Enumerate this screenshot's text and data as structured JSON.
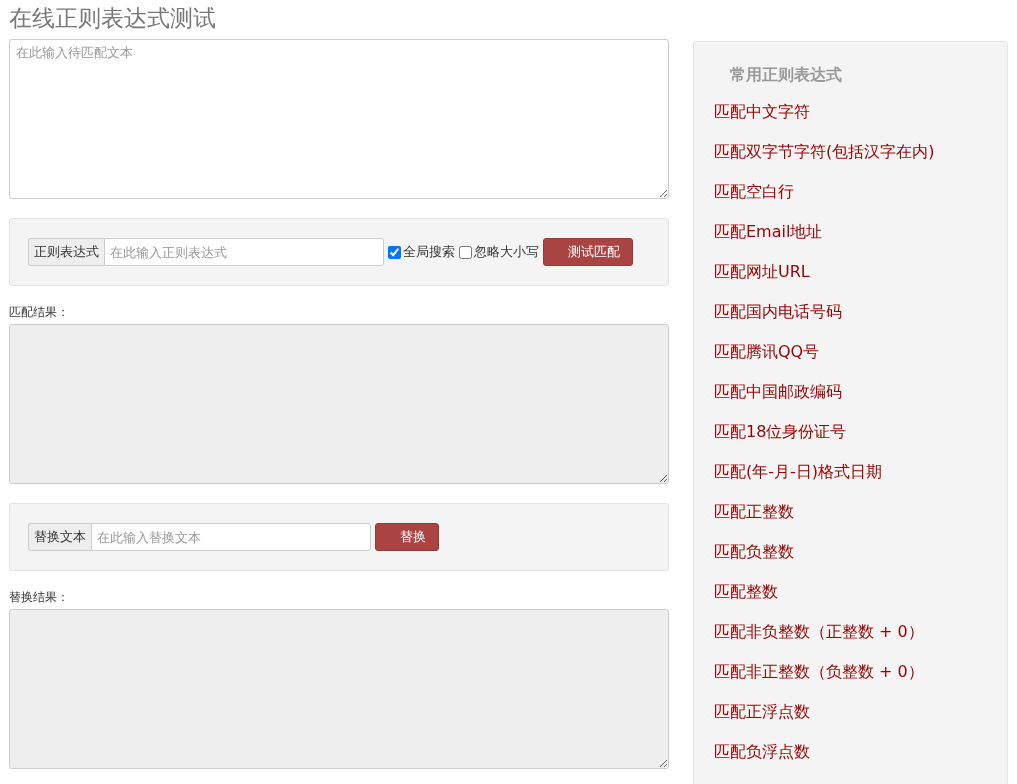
{
  "title": "在线正则表达式测试",
  "source_text": {
    "placeholder": "在此输入待匹配文本"
  },
  "regex_bar": {
    "addon": "正则表达式",
    "placeholder": "在此输入正则表达式",
    "options": [
      {
        "label": "全局搜索",
        "checked": true
      },
      {
        "label": "忽略大小写",
        "checked": false
      }
    ],
    "button": "测试匹配"
  },
  "match_result": {
    "label": "匹配结果：",
    "disabled": true
  },
  "replace_bar": {
    "addon": "替换文本",
    "placeholder": "在此输入替换文本",
    "button": "替换"
  },
  "replace_result": {
    "label": "替换结果：",
    "disabled": true
  },
  "sidebar": {
    "title": "常用正则表达式",
    "items": [
      "匹配中文字符",
      "匹配双字节字符(包括汉字在内)",
      "匹配空白行",
      "匹配Email地址",
      "匹配网址URL",
      "匹配国内电话号码",
      "匹配腾讯QQ号",
      "匹配中国邮政编码",
      "匹配18位身份证号",
      "匹配(年-月-日)格式日期",
      "匹配正整数",
      "匹配负整数",
      "匹配整数",
      "匹配非负整数（正整数 + 0）",
      "匹配非正整数（负整数 + 0）",
      "匹配正浮点数",
      "匹配负浮点数"
    ]
  }
}
